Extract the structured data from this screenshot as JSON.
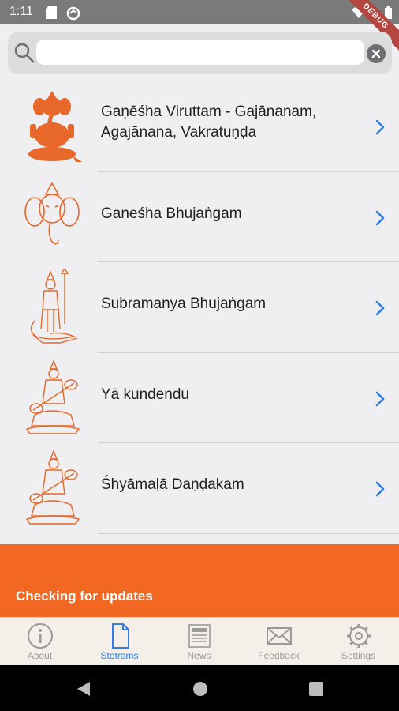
{
  "status": {
    "time": "1:11"
  },
  "debug_label": "DEBUG",
  "search": {
    "placeholder": "",
    "value": ""
  },
  "items": [
    {
      "title": "Gaṇēśha Viruttam - Gajānanam, Agajānana, Vakratuṇḍa",
      "icon": "ganesha-icon"
    },
    {
      "title": "Ganeśha Bhujaṅgam",
      "icon": "ganesha-face-icon"
    },
    {
      "title": "Subramanya Bhujaṅgam",
      "icon": "subramanya-icon"
    },
    {
      "title": "Yā kundendu",
      "icon": "saraswati-icon"
    },
    {
      "title": "Śhyāmaḷā Daṇḍakam",
      "icon": "shyamala-icon"
    }
  ],
  "banner": {
    "text": "Checking for updates"
  },
  "tabs": [
    {
      "label": "About",
      "icon": "info-icon",
      "active": false
    },
    {
      "label": "Stotrams",
      "icon": "document-icon",
      "active": true
    },
    {
      "label": "News",
      "icon": "news-icon",
      "active": false
    },
    {
      "label": "Feedback",
      "icon": "mail-icon",
      "active": false
    },
    {
      "label": "Settings",
      "icon": "gear-icon",
      "active": false
    }
  ],
  "colors": {
    "accent": "#2f7ee6",
    "banner": "#f26722",
    "deity": "#e8672a"
  }
}
